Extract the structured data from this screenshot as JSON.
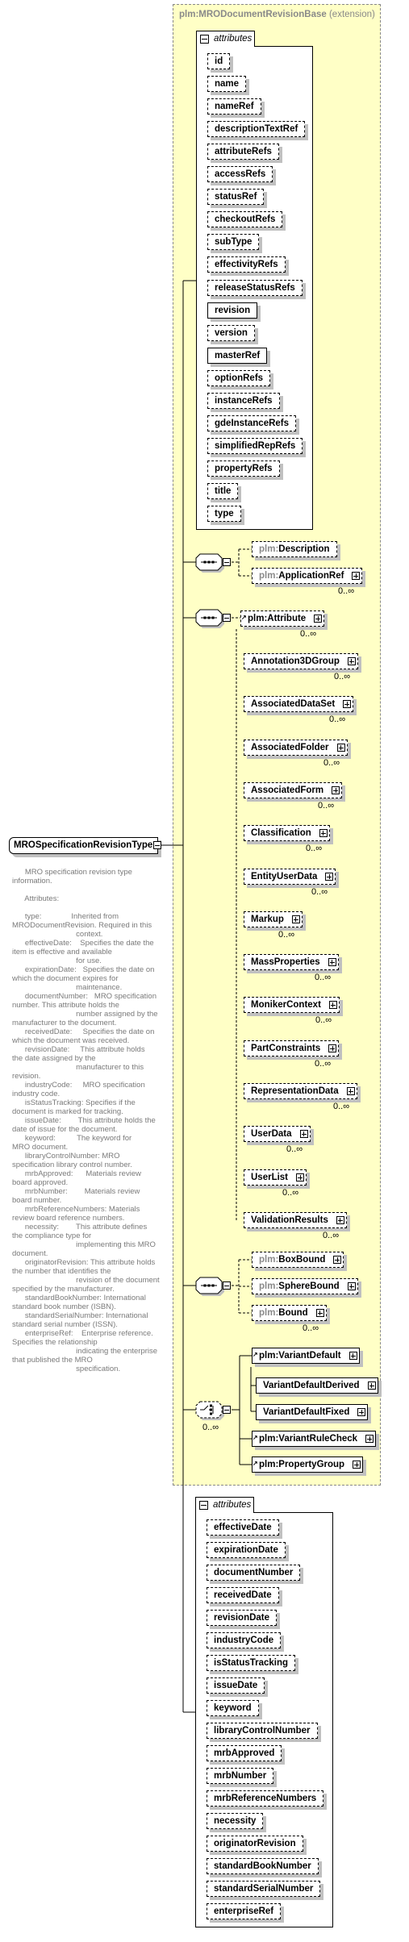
{
  "type_name": "MROSpecificationRevisionType",
  "documentation": [
    "      MRO specification revision type",
    "information.",
    "",
    "      Attributes:",
    "",
    "      type:              Inherited from",
    "MRODocumentRevision. Required in this",
    "                              context.",
    "      effectiveDate:    Specifies the date the",
    "item is effective and available",
    "                              for use.",
    "      expirationDate:   Specifies the date on",
    "which the document expires for",
    "                              maintenance.",
    "      documentNumber:   MRO specification",
    "number. This attribute holds the",
    "                              number assigned by the",
    "manufacturer to the document.",
    "      receivedDate:     Specifies the date on",
    "which the document was received.",
    "      revisionDate:     This attribute holds",
    "the date assigned by the",
    "                              manufacturer to this",
    "revision.",
    "      industryCode:     MRO specification",
    "industry code.",
    "      isStatusTracking: Specifies if the",
    "document is marked for tracking.",
    "      issueDate:        This attribute holds the",
    "date of issue for the document.",
    "      keyword:          The keyword for",
    "MRO document.",
    "      libraryControlNumber: MRO",
    "specification library control number.",
    "      mrbApproved:      Materials review",
    "board approved.",
    "      mrbNumber:        Materials review",
    "board number.",
    "      mrbReferenceNumbers: Materials",
    "review board reference numbers.",
    "      necessity:        This attribute defines",
    "the compliance type for",
    "                              implementing this MRO",
    "document.",
    "      originatorRevision: This attribute holds",
    "the number that identifies the",
    "                              revision of the document",
    "specified by the manufacturer.",
    "      standardBookNumber: International",
    "standard book number (ISBN).",
    "      standardSerialNumber: International",
    "standard serial number (ISSN).",
    "      enterpriseRef:    Enterprise reference.",
    "Specifies the relationship",
    "                              indicating the enterprise",
    "that published the MRO",
    "                              specification."
  ],
  "extension": {
    "base_name": "plm:MRODocumentRevisionBase",
    "label": "(extension)"
  },
  "base_attributes": {
    "title": "attributes",
    "items": [
      {
        "name": "id",
        "optional": true
      },
      {
        "name": "name",
        "optional": true
      },
      {
        "name": "nameRef",
        "optional": true
      },
      {
        "name": "descriptionTextRef",
        "optional": true
      },
      {
        "name": "attributeRefs",
        "optional": true
      },
      {
        "name": "accessRefs",
        "optional": true
      },
      {
        "name": "statusRef",
        "optional": true
      },
      {
        "name": "checkoutRefs",
        "optional": true
      },
      {
        "name": "subType",
        "optional": true
      },
      {
        "name": "effectivityRefs",
        "optional": true
      },
      {
        "name": "releaseStatusRefs",
        "optional": true
      },
      {
        "name": "revision",
        "optional": false
      },
      {
        "name": "version",
        "optional": true
      },
      {
        "name": "masterRef",
        "optional": false
      },
      {
        "name": "optionRefs",
        "optional": true
      },
      {
        "name": "instanceRefs",
        "optional": true
      },
      {
        "name": "gdeInstanceRefs",
        "optional": true
      },
      {
        "name": "simplifiedRepRefs",
        "optional": true
      },
      {
        "name": "propertyRefs",
        "optional": true
      },
      {
        "name": "title",
        "optional": true
      },
      {
        "name": "type",
        "optional": true
      }
    ]
  },
  "groups": [
    {
      "compositor": "sequence",
      "elements": [
        {
          "prefix": "plm:",
          "name": "Description",
          "optional": true,
          "prefix_grey": true,
          "expandable": false,
          "occurs": ""
        },
        {
          "prefix": "plm:",
          "name": "ApplicationRef",
          "optional": true,
          "prefix_grey": true,
          "expandable": true,
          "occurs": "0..∞"
        }
      ]
    },
    {
      "compositor": "sequence",
      "elements": [
        {
          "prefix": "plm:",
          "name": "Attribute",
          "optional": true,
          "prefix_grey": false,
          "expandable": true,
          "occurs": "0..∞",
          "ref": true
        },
        {
          "prefix": "",
          "name": "Annotation3DGroup",
          "optional": true,
          "expandable": true,
          "occurs": "0..∞"
        },
        {
          "prefix": "",
          "name": "AssociatedDataSet",
          "optional": true,
          "expandable": true,
          "occurs": "0..∞"
        },
        {
          "prefix": "",
          "name": "AssociatedFolder",
          "optional": true,
          "expandable": true,
          "occurs": "0..∞"
        },
        {
          "prefix": "",
          "name": "AssociatedForm",
          "optional": true,
          "expandable": true,
          "occurs": "0..∞"
        },
        {
          "prefix": "",
          "name": "Classification",
          "optional": true,
          "expandable": true,
          "occurs": "0..∞"
        },
        {
          "prefix": "",
          "name": "EntityUserData",
          "optional": true,
          "expandable": true,
          "occurs": "0..∞"
        },
        {
          "prefix": "",
          "name": "Markup",
          "optional": true,
          "expandable": true,
          "occurs": "0..∞"
        },
        {
          "prefix": "",
          "name": "MassProperties",
          "optional": true,
          "expandable": true,
          "occurs": "0..∞"
        },
        {
          "prefix": "",
          "name": "MonikerContext",
          "optional": true,
          "expandable": true,
          "occurs": "0..∞"
        },
        {
          "prefix": "",
          "name": "PartConstraints",
          "optional": true,
          "expandable": true,
          "occurs": "0..∞"
        },
        {
          "prefix": "",
          "name": "RepresentationData",
          "optional": true,
          "expandable": true,
          "occurs": "0..∞"
        },
        {
          "prefix": "",
          "name": "UserData",
          "optional": true,
          "expandable": true,
          "occurs": "0..∞"
        },
        {
          "prefix": "",
          "name": "UserList",
          "optional": true,
          "expandable": true,
          "occurs": "0..∞"
        },
        {
          "prefix": "",
          "name": "ValidationResults",
          "optional": true,
          "expandable": true,
          "occurs": "0..∞"
        }
      ]
    },
    {
      "compositor": "sequence",
      "elements": [
        {
          "prefix": "plm:",
          "name": "BoxBound",
          "optional": true,
          "prefix_grey": true,
          "expandable": true,
          "occurs": ""
        },
        {
          "prefix": "plm:",
          "name": "SphereBound",
          "optional": true,
          "prefix_grey": true,
          "expandable": true,
          "occurs": ""
        },
        {
          "prefix": "plm:",
          "name": "Bound",
          "optional": true,
          "prefix_grey": true,
          "expandable": true,
          "occurs": "0..∞"
        }
      ]
    },
    {
      "compositor": "choice",
      "occurs": "0..∞",
      "elements": [
        {
          "prefix": "plm:",
          "name": "VariantDefault",
          "optional": false,
          "prefix_grey": false,
          "expandable": true,
          "occurs": "",
          "ref": true
        },
        {
          "prefix": "",
          "name": "VariantDefaultDerived",
          "optional": false,
          "expandable": true,
          "occurs": ""
        },
        {
          "prefix": "",
          "name": "VariantDefaultFixed",
          "optional": false,
          "expandable": true,
          "occurs": ""
        },
        {
          "prefix": "plm:",
          "name": "VariantRuleCheck",
          "optional": false,
          "prefix_grey": false,
          "expandable": true,
          "occurs": "",
          "ref": true
        },
        {
          "prefix": "plm:",
          "name": "PropertyGroup",
          "optional": false,
          "prefix_grey": false,
          "expandable": true,
          "occurs": "",
          "ref": true
        }
      ]
    }
  ],
  "own_attributes": {
    "title": "attributes",
    "items": [
      {
        "name": "effectiveDate",
        "optional": true
      },
      {
        "name": "expirationDate",
        "optional": true
      },
      {
        "name": "documentNumber",
        "optional": true
      },
      {
        "name": "receivedDate",
        "optional": true
      },
      {
        "name": "revisionDate",
        "optional": true
      },
      {
        "name": "industryCode",
        "optional": true
      },
      {
        "name": "isStatusTracking",
        "optional": true
      },
      {
        "name": "issueDate",
        "optional": true
      },
      {
        "name": "keyword",
        "optional": true
      },
      {
        "name": "libraryControlNumber",
        "optional": true
      },
      {
        "name": "mrbApproved",
        "optional": true
      },
      {
        "name": "mrbNumber",
        "optional": true
      },
      {
        "name": "mrbReferenceNumbers",
        "optional": true
      },
      {
        "name": "necessity",
        "optional": true
      },
      {
        "name": "originatorRevision",
        "optional": true
      },
      {
        "name": "standardBookNumber",
        "optional": true
      },
      {
        "name": "standardSerialNumber",
        "optional": true
      },
      {
        "name": "enterpriseRef",
        "optional": true
      }
    ]
  },
  "colors": {
    "extension_bg": "#ffffc6",
    "shadow": "#c0c0c0",
    "doc_text": "#7a7a7a",
    "prefix_grey": "#8a8a8a"
  }
}
